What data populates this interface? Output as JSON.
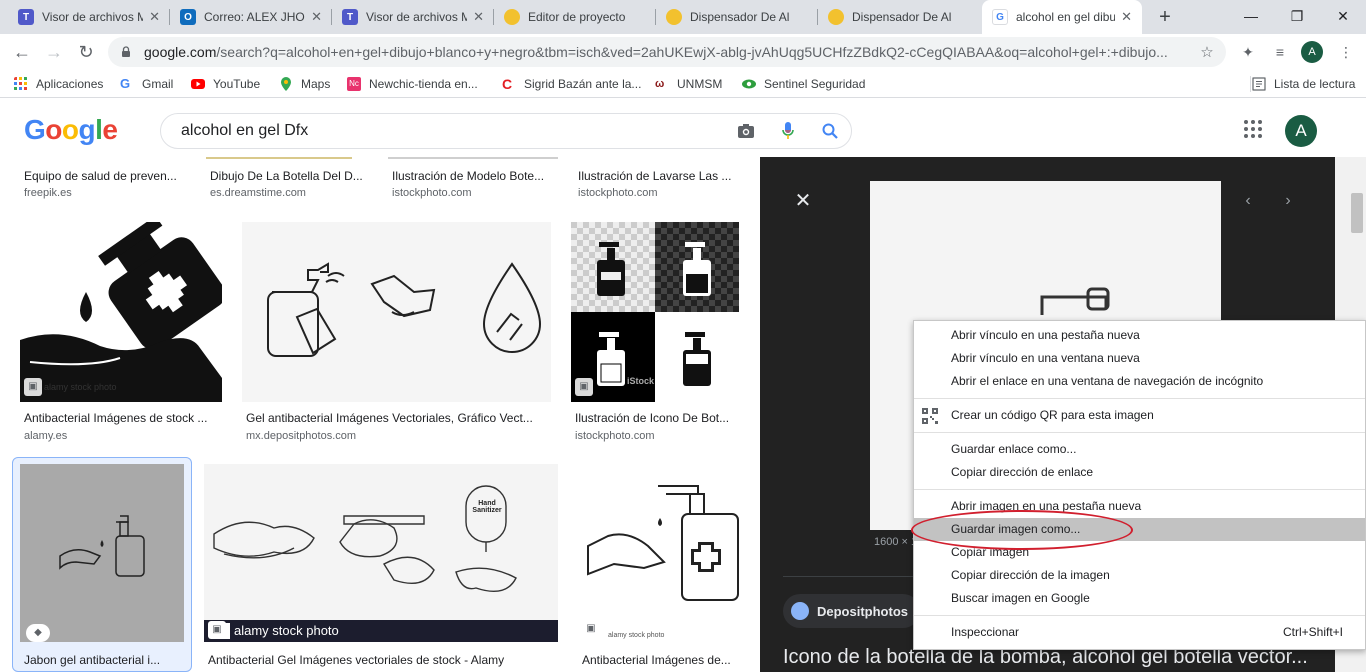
{
  "tabs": [
    {
      "title": "Visor de archivos M",
      "icon": "teams-icon",
      "color": "#5059c9",
      "active": false
    },
    {
      "title": "Correo: ALEX JHON",
      "icon": "outlook-icon",
      "color": "#0f6cbd",
      "active": false
    },
    {
      "title": "Visor de archivos M",
      "icon": "teams-icon",
      "color": "#5059c9",
      "active": false
    },
    {
      "title": "Editor de proyecto",
      "icon": "tinkercad-icon",
      "color": "#f2c12e",
      "active": false
    },
    {
      "title": "Dispensador De Al",
      "icon": "tinkercad-icon",
      "color": "#f2c12e",
      "active": false
    },
    {
      "title": "Dispensador De Al",
      "icon": "tinkercad-icon",
      "color": "#f2c12e",
      "active": false
    },
    {
      "title": "alcohol en gel dibu",
      "icon": "google-icon",
      "color": "#4285f4",
      "active": true
    }
  ],
  "omnibox": {
    "host": "google.com",
    "path": "/search?q=alcohol+en+gel+dibujo+blanco+y+negro&tbm=isch&ved=2ahUKEwjX-ablg-jvAhUqg5UCHfzZBdkQ2-cCegQIABAA&oq=alcohol+gel+:+dibujo..."
  },
  "profile_initial": "A",
  "bookmarks": [
    {
      "label": "Aplicaciones",
      "icon": "apps-icon",
      "color": "#ea4335"
    },
    {
      "label": "Gmail",
      "icon": "google-icon",
      "color": "#4285f4"
    },
    {
      "label": "YouTube",
      "icon": "youtube-icon",
      "color": "#ff0000"
    },
    {
      "label": "Maps",
      "icon": "maps-icon",
      "color": "#34a853"
    },
    {
      "label": "Newchic-tienda en...",
      "icon": "newchic-icon",
      "color": "#e8336d"
    },
    {
      "label": "Sigrid Bazán ante la...",
      "icon": "c-icon",
      "color": "#e31e24"
    },
    {
      "label": "UNMSM",
      "icon": "unmsm-icon",
      "color": "#8b1a1a"
    },
    {
      "label": "Sentinel Seguridad",
      "icon": "eye-icon",
      "color": "#2e9e3e"
    }
  ],
  "reading_list_label": "Lista de lectura",
  "google": {
    "logo_letters": [
      "G",
      "o",
      "o",
      "g",
      "l",
      "e"
    ],
    "logo_colors": [
      "#4285f4",
      "#ea4335",
      "#fbbc05",
      "#4285f4",
      "#34a853",
      "#ea4335"
    ],
    "query": "alcohol en gel Dfx"
  },
  "results": {
    "row0": [
      {
        "title": "Equipo de salud de preven...",
        "source": "freepik.es"
      },
      {
        "title": "Dibujo De La Botella Del D...",
        "source": "es.dreamstime.com"
      },
      {
        "title": "Ilustración de Modelo Bote...",
        "source": "istockphoto.com"
      },
      {
        "title": "Ilustración de Lavarse Las ...",
        "source": "istockphoto.com"
      }
    ],
    "row1": [
      {
        "title": "Antibacterial Imágenes de stock ...",
        "source": "alamy.es",
        "watermark": "alamy stock photo"
      },
      {
        "title": "Gel antibacterial Imágenes Vectoriales, Gráfico Vect...",
        "source": "mx.depositphotos.com"
      },
      {
        "title": "Ilustración de Icono De Bot...",
        "source": "istockphoto.com",
        "watermark": "iStock"
      }
    ],
    "row2": [
      {
        "title": "Jabon gel antibacterial i...",
        "source": ""
      },
      {
        "title": "Antibacterial Gel Imágenes vectoriales de stock - Alamy",
        "source": "",
        "banner": "alamy stock photo",
        "bottle_label": "Hand Sanitizer"
      },
      {
        "title": "Antibacterial Imágenes de...",
        "source": "",
        "watermark": "alamy stock photo"
      }
    ]
  },
  "panel": {
    "dimensions": "1600 × 1",
    "source_name": "Depositphotos",
    "title": "Icono de la botella de la bomba, alcohol gel botella vector..."
  },
  "context_menu": [
    {
      "label": "Abrir vínculo en una pestaña nueva"
    },
    {
      "label": "Abrir vínculo en una ventana nueva"
    },
    {
      "label": "Abrir el enlace en una ventana de navegación de incógnito"
    },
    {
      "sep": true
    },
    {
      "label": "Crear un código QR para esta imagen",
      "icon": "qr-icon"
    },
    {
      "sep": true
    },
    {
      "label": "Guardar enlace como..."
    },
    {
      "label": "Copiar dirección de enlace"
    },
    {
      "sep": true
    },
    {
      "label": "Abrir imagen en una pestaña nueva"
    },
    {
      "label": "Guardar imagen como...",
      "highlighted": true
    },
    {
      "label": "Copiar imagen"
    },
    {
      "label": "Copiar dirección de la imagen"
    },
    {
      "label": "Buscar imagen en Google"
    },
    {
      "sep": true
    },
    {
      "label": "Inspeccionar",
      "shortcut": "Ctrl+Shift+I"
    }
  ]
}
